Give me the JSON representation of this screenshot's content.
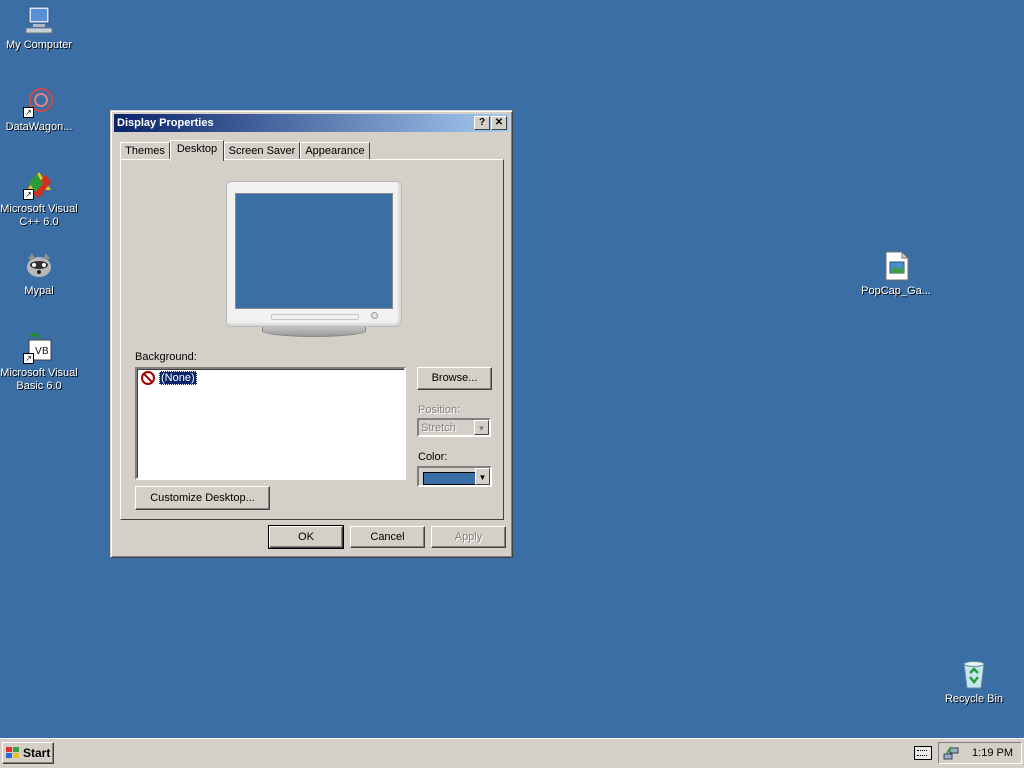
{
  "desktop": {
    "icons": [
      {
        "label": "My Computer",
        "icon": "my-computer-icon"
      },
      {
        "label": "DataWagon...",
        "icon": "datawagon-icon"
      },
      {
        "label": "Microsoft Visual C++ 6.0",
        "icon": "visual-cpp-icon"
      },
      {
        "label": "Mypal",
        "icon": "mypal-icon"
      },
      {
        "label": "Microsoft Visual Basic 6.0",
        "icon": "visual-basic-icon"
      },
      {
        "label": "PopCap_Ga...",
        "icon": "image-file-icon"
      },
      {
        "label": "Recycle Bin",
        "icon": "recycle-bin-icon"
      }
    ],
    "background_color": "#3A6EA5"
  },
  "dialog": {
    "title": "Display Properties",
    "help_label": "?",
    "close_label": "✕",
    "tabs": [
      {
        "label": "Themes"
      },
      {
        "label": "Desktop"
      },
      {
        "label": "Screen Saver"
      },
      {
        "label": "Appearance"
      }
    ],
    "active_tab": "Desktop",
    "background_label": "Background:",
    "background_items": [
      "(None)"
    ],
    "browse_label": "Browse...",
    "position_label": "Position:",
    "position_value": "Stretch",
    "color_label": "Color:",
    "color_value": "#3A6EA5",
    "customize_label": "Customize Desktop...",
    "ok_label": "OK",
    "cancel_label": "Cancel",
    "apply_label": "Apply"
  },
  "taskbar": {
    "start_label": "Start",
    "clock": "1:19 PM"
  }
}
